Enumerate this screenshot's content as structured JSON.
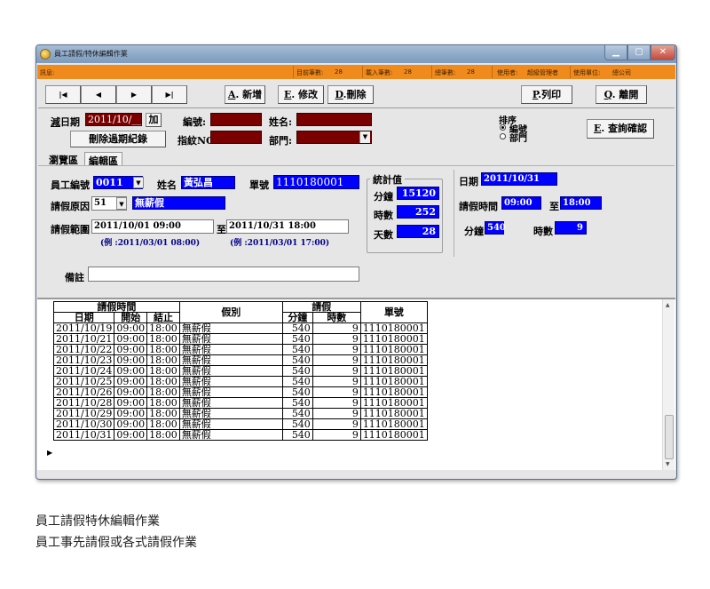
{
  "window": {
    "title": "員工請假/特休編輯作業",
    "controls": {
      "minimize": "▁",
      "maximize": "▢",
      "close": "✕"
    }
  },
  "infobar": {
    "message_label": "訊息:",
    "current_count_label": "目前筆數:",
    "current_count": "28",
    "loaded_count_label": "載入筆數:",
    "loaded_count": "28",
    "total_count_label": "總筆數:",
    "total_count": "28",
    "user_label": "使用者:",
    "user": "超級管理者",
    "unit_label": "使用單位:",
    "unit": "總公司"
  },
  "toolbar": {
    "first": "|◀",
    "prev": "◀",
    "next": "▶",
    "last": "▶|",
    "add_key": "A",
    "add": ". 新增",
    "edit_key": "E",
    "edit": ". 修改",
    "delete_key": "D",
    "delete": ".刪除",
    "print_key": "P",
    "print": ".列印",
    "exit_key": "Q",
    "exit": ". 離開"
  },
  "filter": {
    "minus_key": "減",
    "date_label": "日期",
    "date_value": "2011/10/__",
    "plus_button": "加",
    "emp_no_label": "編號:",
    "name_label": "姓名:",
    "fingerprint_label": "指紋NO.:",
    "dept_label": "部門:",
    "delete_expired_button": "刪除過期紀錄",
    "sort_title": "排序",
    "sort_options": [
      "編號",
      "部門"
    ],
    "query_confirm_key": "E",
    "query_confirm": ". 查詢確認"
  },
  "tabs": {
    "browse": "瀏覽區",
    "edit": "編輯區"
  },
  "form": {
    "emp_no_label": "員工編號",
    "emp_no": "0011",
    "name_label": "姓名",
    "name": "黃弘昌",
    "doc_no_label": "單號",
    "doc_no": "1110180001",
    "reason_label": "請假原因",
    "reason_code": "51",
    "reason_name": "無薪假",
    "range_label": "請假範圍",
    "range_from": "2011/10/01 09:00",
    "range_to_label": "至",
    "range_to": "2011/10/31 18:00",
    "range_from_example": "(例 :2011/03/01 08:00)",
    "range_to_example": "(例 :2011/03/01 17:00)",
    "stats_title": "統計值",
    "minutes_label": "分鐘",
    "minutes": "15120",
    "hours_label": "時數",
    "hours": "252",
    "days_label": "天數",
    "days": "28",
    "date_label": "日期",
    "date": "2011/10/31",
    "time_label": "請假時間",
    "time_from": "09:00",
    "time_to_label": "至",
    "time_to": "18:00",
    "right_minutes_label": "分鐘",
    "right_minutes": "540",
    "right_hours_label": "時數",
    "right_hours": "9",
    "note_label": "備註",
    "note": ""
  },
  "grid": {
    "headers": {
      "leave_time": "請假時間",
      "date": "日期",
      "start": "開始",
      "end": "結止",
      "type": "假別",
      "leave": "請假",
      "minutes": "分鐘",
      "hours": "時數",
      "doc_no": "單號"
    },
    "rows": [
      [
        "2011/10/19",
        "09:00",
        "18:00",
        "無薪假",
        "540",
        "9",
        "1110180001"
      ],
      [
        "2011/10/21",
        "09:00",
        "18:00",
        "無薪假",
        "540",
        "9",
        "1110180001"
      ],
      [
        "2011/10/22",
        "09:00",
        "18:00",
        "無薪假",
        "540",
        "9",
        "1110180001"
      ],
      [
        "2011/10/23",
        "09:00",
        "18:00",
        "無薪假",
        "540",
        "9",
        "1110180001"
      ],
      [
        "2011/10/24",
        "09:00",
        "18:00",
        "無薪假",
        "540",
        "9",
        "1110180001"
      ],
      [
        "2011/10/25",
        "09:00",
        "18:00",
        "無薪假",
        "540",
        "9",
        "1110180001"
      ],
      [
        "2011/10/26",
        "09:00",
        "18:00",
        "無薪假",
        "540",
        "9",
        "1110180001"
      ],
      [
        "2011/10/28",
        "09:00",
        "18:00",
        "無薪假",
        "540",
        "9",
        "1110180001"
      ],
      [
        "2011/10/29",
        "09:00",
        "18:00",
        "無薪假",
        "540",
        "9",
        "1110180001"
      ],
      [
        "2011/10/30",
        "09:00",
        "18:00",
        "無薪假",
        "540",
        "9",
        "1110180001"
      ],
      [
        "2011/10/31",
        "09:00",
        "18:00",
        "無薪假",
        "540",
        "9",
        "1110180001"
      ]
    ],
    "current_row_marker": "▶"
  },
  "captions": {
    "line1": "員工請假特休編輯作業",
    "line2": "員工事先請假或各式請假作業"
  }
}
